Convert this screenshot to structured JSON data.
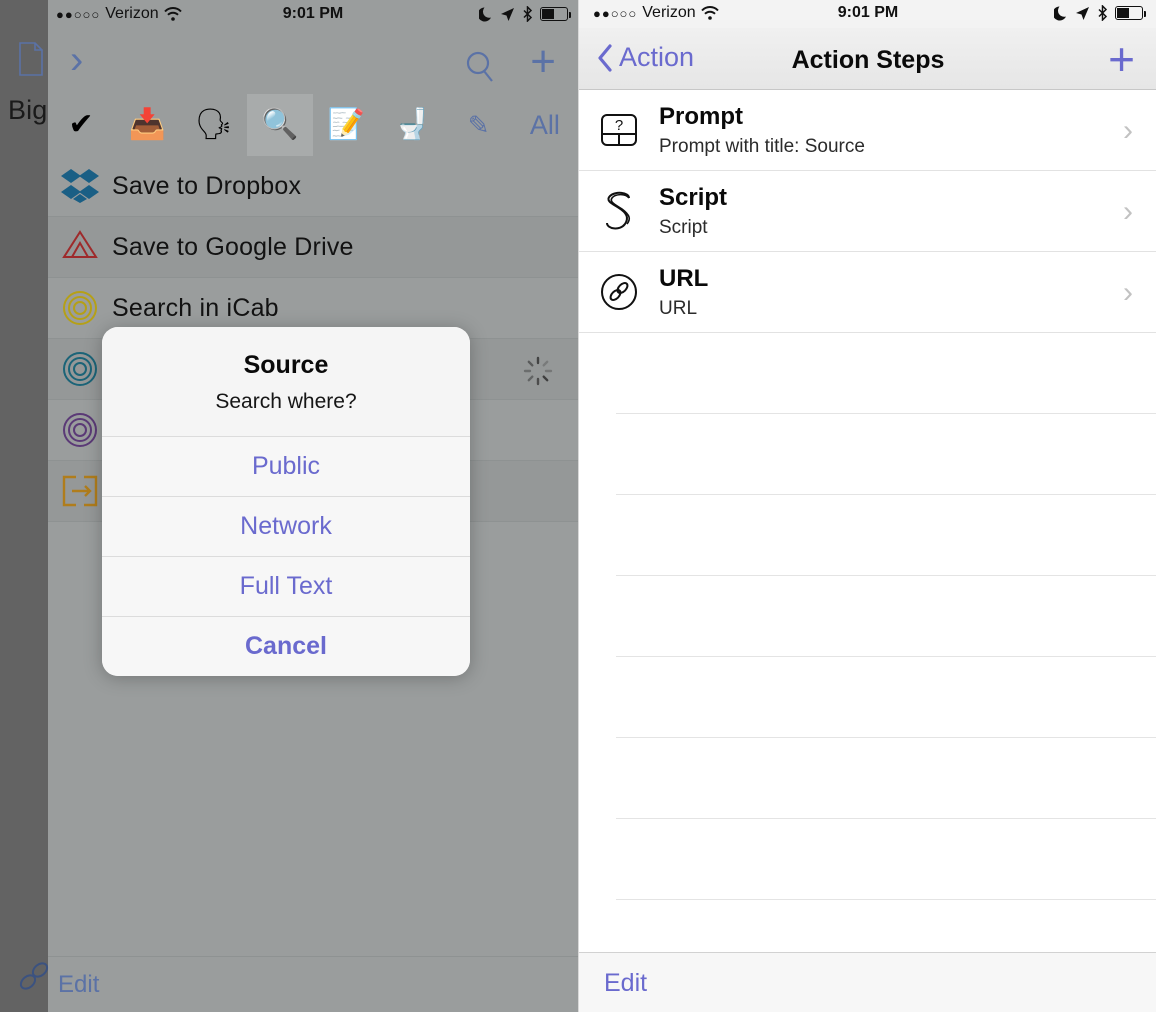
{
  "left": {
    "status": {
      "carrier": "Verizon",
      "signal_dots": "●●○○○",
      "time": "9:01 PM",
      "battery_pct": 50
    },
    "nav": {
      "back_icon": "chevron-right-icon",
      "search_icon": "magnifier-icon",
      "add_icon": "plus-icon"
    },
    "tabs": [
      {
        "name": "check",
        "glyph": "✔",
        "selected": false
      },
      {
        "name": "inbox-tray",
        "glyph": "📥",
        "selected": false
      },
      {
        "name": "speaking-head",
        "glyph": "🗣",
        "selected": false
      },
      {
        "name": "magnifier",
        "glyph": "🔍",
        "selected": true
      },
      {
        "name": "memo",
        "glyph": "📝",
        "selected": false
      },
      {
        "name": "toilet",
        "glyph": "🚽",
        "selected": false
      },
      {
        "name": "pencil",
        "glyph": "✎",
        "selected": false
      },
      {
        "name": "all",
        "glyph": "All",
        "selected": false
      }
    ],
    "rows": [
      {
        "label": "Save to Dropbox",
        "icon": "dropbox-icon",
        "color": "#1a5f85"
      },
      {
        "label": "Save to Google Drive",
        "icon": "google-drive-icon",
        "color": "#9e2a2b"
      },
      {
        "label": "Search in iCab",
        "icon": "target-icon",
        "color": "#b5a017"
      },
      {
        "label": "",
        "icon": "target-icon",
        "color": "#1b6478",
        "spinner": true
      },
      {
        "label": "",
        "icon": "target-icon",
        "color": "#5b3a77"
      },
      {
        "label": "",
        "icon": "open-in-icon",
        "color": "#b07d1c"
      }
    ],
    "edit_label": "Edit",
    "master": {
      "title": "Big",
      "doc_icon": "document-icon",
      "link_icon": "link-icon"
    },
    "alert": {
      "title": "Source",
      "message": "Search where?",
      "buttons": [
        {
          "label": "Public",
          "style": "default"
        },
        {
          "label": "Network",
          "style": "default"
        },
        {
          "label": "Full Text",
          "style": "default"
        },
        {
          "label": "Cancel",
          "style": "cancel"
        }
      ]
    }
  },
  "right": {
    "status": {
      "carrier": "Verizon",
      "signal_dots": "●●○○○",
      "time": "9:01 PM",
      "battery_pct": 50
    },
    "nav": {
      "back_label": "Action",
      "title": "Action Steps",
      "add_icon": "plus-icon"
    },
    "items": [
      {
        "title": "Prompt",
        "subtitle": "Prompt with title: Source",
        "icon": "prompt-icon"
      },
      {
        "title": "Script",
        "subtitle": "Script",
        "icon": "script-icon"
      },
      {
        "title": "URL",
        "subtitle": "URL",
        "icon": "url-link-icon"
      }
    ],
    "empty_row_count": 8,
    "edit_label": "Edit"
  },
  "colors": {
    "accent": "#6a6ace",
    "dim_bg": "#9a9d9d",
    "dim_master": "#636363",
    "left_accent": "#5b72a6"
  }
}
